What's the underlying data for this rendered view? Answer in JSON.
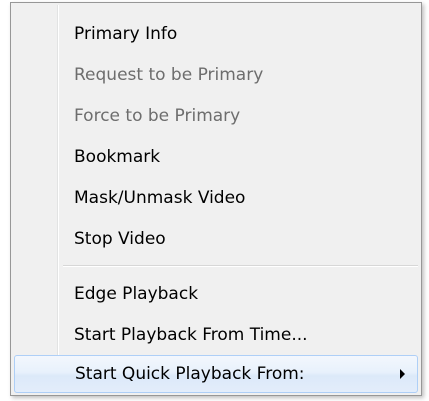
{
  "menu": {
    "items": [
      {
        "label": "Primary Info",
        "enabled": true
      },
      {
        "label": "Request to be Primary",
        "enabled": false
      },
      {
        "label": "Force to be Primary",
        "enabled": false
      },
      {
        "label": "Bookmark",
        "enabled": true
      },
      {
        "label": "Mask/Unmask Video",
        "enabled": true
      },
      {
        "label": "Stop Video",
        "enabled": true
      },
      {
        "label": "Edge Playback",
        "enabled": true
      },
      {
        "label": "Start Playback From Time...",
        "enabled": true
      },
      {
        "label": "Start Quick Playback From:",
        "enabled": true,
        "has_submenu": true,
        "highlighted": true
      }
    ],
    "submenu_icon": "chevron-right-icon",
    "colors": {
      "background": "#f0f0f0",
      "disabled_text": "#6d6d6d",
      "highlight_border": "#aecff7"
    }
  }
}
